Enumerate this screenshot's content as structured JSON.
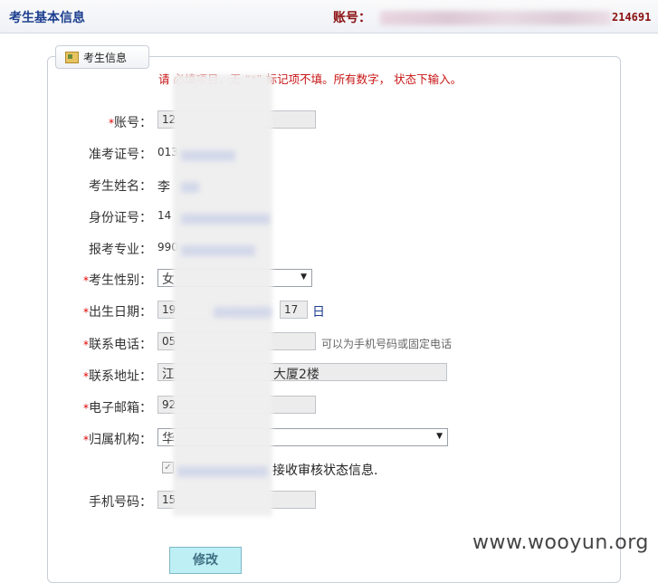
{
  "header": {
    "title": "考生基本信息",
    "account_label": "账号：",
    "account_tail": "214691"
  },
  "panel": {
    "tab_label": "考生信息"
  },
  "notice": "请 必填项目，无 “*” 标记项不填。所有数字， 状态下输入。",
  "required_mark": "*",
  "fields": {
    "account": {
      "label": "账号：",
      "value": "12"
    },
    "exam_no": {
      "label": "准考证号：",
      "value": "013"
    },
    "name": {
      "label": "考生姓名：",
      "value": "李"
    },
    "id_no": {
      "label": "身份证号：",
      "value": "14"
    },
    "major": {
      "label": "报考专业：",
      "value": "990"
    },
    "gender": {
      "label": "考生性别：",
      "value": "女"
    },
    "birth": {
      "label": "出生日期：",
      "year": "19",
      "day": "17",
      "day_unit": "日"
    },
    "phone": {
      "label": "联系电话：",
      "value": "05",
      "hint": "可以为手机号码或固定电话"
    },
    "address": {
      "label": "联系地址：",
      "value_start": "江",
      "value_end": "大厦2楼"
    },
    "email": {
      "label": "电子邮箱：",
      "value": "92"
    },
    "org": {
      "label": "归属机构：",
      "value": "华"
    },
    "notify": {
      "text": "接收审核状态信息."
    },
    "mobile": {
      "label": "手机号码：",
      "value": "15"
    }
  },
  "submit_label": "修改",
  "watermark": "www.wooyun.org"
}
